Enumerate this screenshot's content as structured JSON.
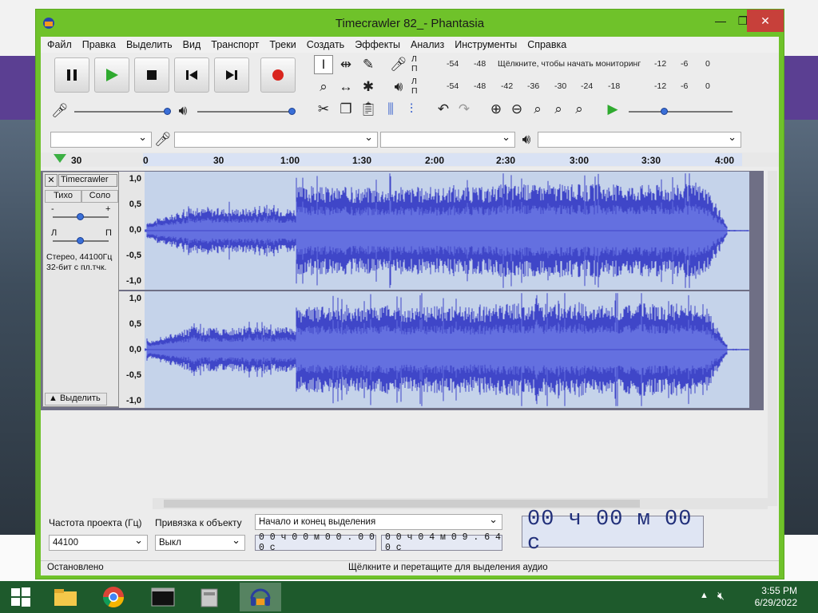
{
  "window": {
    "title": "Timecrawler 82_- Phantasia",
    "minimize": "—",
    "maximize": "❐",
    "close": "✕"
  },
  "menu": [
    "Файл",
    "Правка",
    "Выделить",
    "Вид",
    "Транспорт",
    "Треки",
    "Создать",
    "Эффекты",
    "Анализ",
    "Инструменты",
    "Справка"
  ],
  "meters": {
    "record": {
      "channel_l": "Л",
      "channel_r": "П",
      "ticks": [
        "-54",
        "-48",
        "-12",
        "-6",
        "0"
      ],
      "prompt": "Щёлкните, чтобы начать мониторинг"
    },
    "playback": {
      "channel_l": "Л",
      "channel_r": "П",
      "ticks": [
        "-54",
        "-48",
        "-42",
        "-36",
        "-30",
        "-24",
        "-18",
        "-12",
        "-6",
        "0"
      ]
    }
  },
  "ruler": {
    "ticks": [
      "30",
      "0",
      "30",
      "1:00",
      "1:30",
      "2:00",
      "2:30",
      "3:00",
      "3:30",
      "4:00"
    ]
  },
  "track": {
    "name": "Timecrawler",
    "mute": "Тихо",
    "solo": "Соло",
    "gain_minus": "-",
    "gain_plus": "+",
    "pan_left": "Л",
    "pan_right": "П",
    "info": "Стерео, 44100Гц\n32-бит с пл.тчк.",
    "select": "Выделить",
    "scale": [
      "1,0",
      "0,5",
      "0,0",
      "-0,5",
      "-1,0"
    ]
  },
  "selection": {
    "rate_label": "Частота проекта (Гц)",
    "rate_value": "44100",
    "snap_label": "Привязка к объекту",
    "snap_value": "Выкл",
    "mode_value": "Начало и конец выделения",
    "start_time": "0 0 ч 0 0 м 0 0 . 0 0 0 с",
    "end_time": "0 0 ч 0 4 м 0 9 . 6 4 0 с",
    "position": "00 ч 00 м 00 с"
  },
  "status": {
    "left": "Остановлено",
    "center": "Щёлкните и перетащите для выделения аудио"
  },
  "clock": {
    "time": "3:55 PM",
    "date": "6/29/2022"
  },
  "colors": {
    "titlebar": "#6fc22a",
    "waveform": "#3f46c8",
    "waveform_bg": "#c5d3ea",
    "record": "#d9251e"
  }
}
